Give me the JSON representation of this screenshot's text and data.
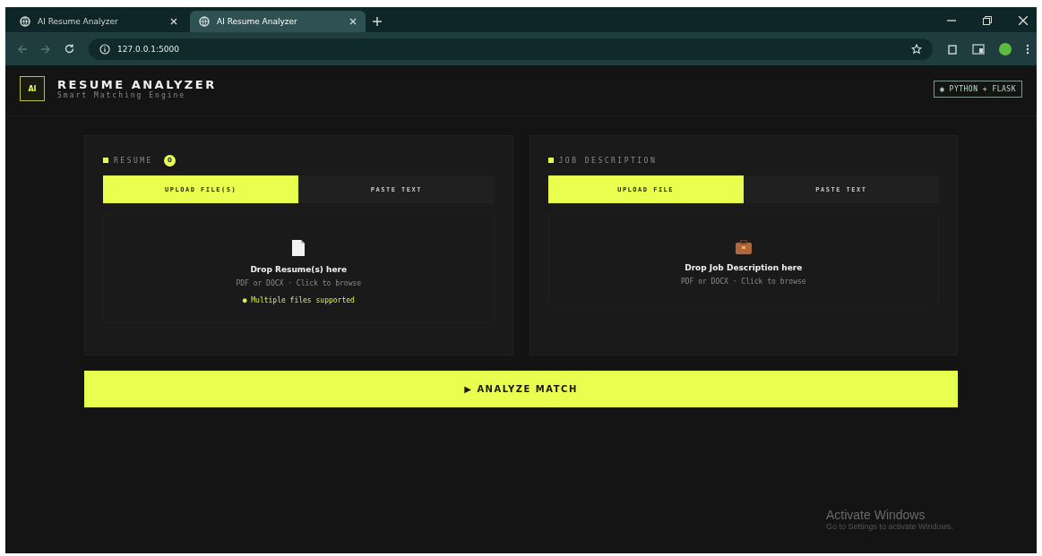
{
  "browser": {
    "tabs": [
      {
        "title": "AI Resume Analyzer",
        "selected": false
      },
      {
        "title": "AI Resume Analyzer",
        "selected": true
      }
    ],
    "url": "127.0.0.1:5000"
  },
  "header": {
    "logo": "AI",
    "title": "RESUME ANALYZER",
    "subtitle": "Smart Matching Engine",
    "badge": "◉ PYTHON + FLASK"
  },
  "panels": [
    {
      "label": "RESUME",
      "count": "0",
      "tabs": [
        {
          "label": "UPLOAD FILE(S)",
          "selected": true
        },
        {
          "label": "PASTE TEXT",
          "selected": false
        }
      ],
      "drop": {
        "kind": "document",
        "title": "Drop Resume(s) here",
        "hint": "PDF or DOCX · Click to browse",
        "note": "● Multiple files supported"
      }
    },
    {
      "label": "JOB DESCRIPTION",
      "tabs": [
        {
          "label": "UPLOAD FILE",
          "selected": true
        },
        {
          "label": "PASTE TEXT",
          "selected": false
        }
      ],
      "drop": {
        "kind": "briefcase",
        "title": "Drop Job Description here",
        "hint": "PDF or DOCX · Click to browse"
      }
    }
  ],
  "analyze_button": "▶ ANALYZE MATCH",
  "os_notice": {
    "title": "Activate Windows",
    "text": "Go to Settings to activate Windows."
  }
}
